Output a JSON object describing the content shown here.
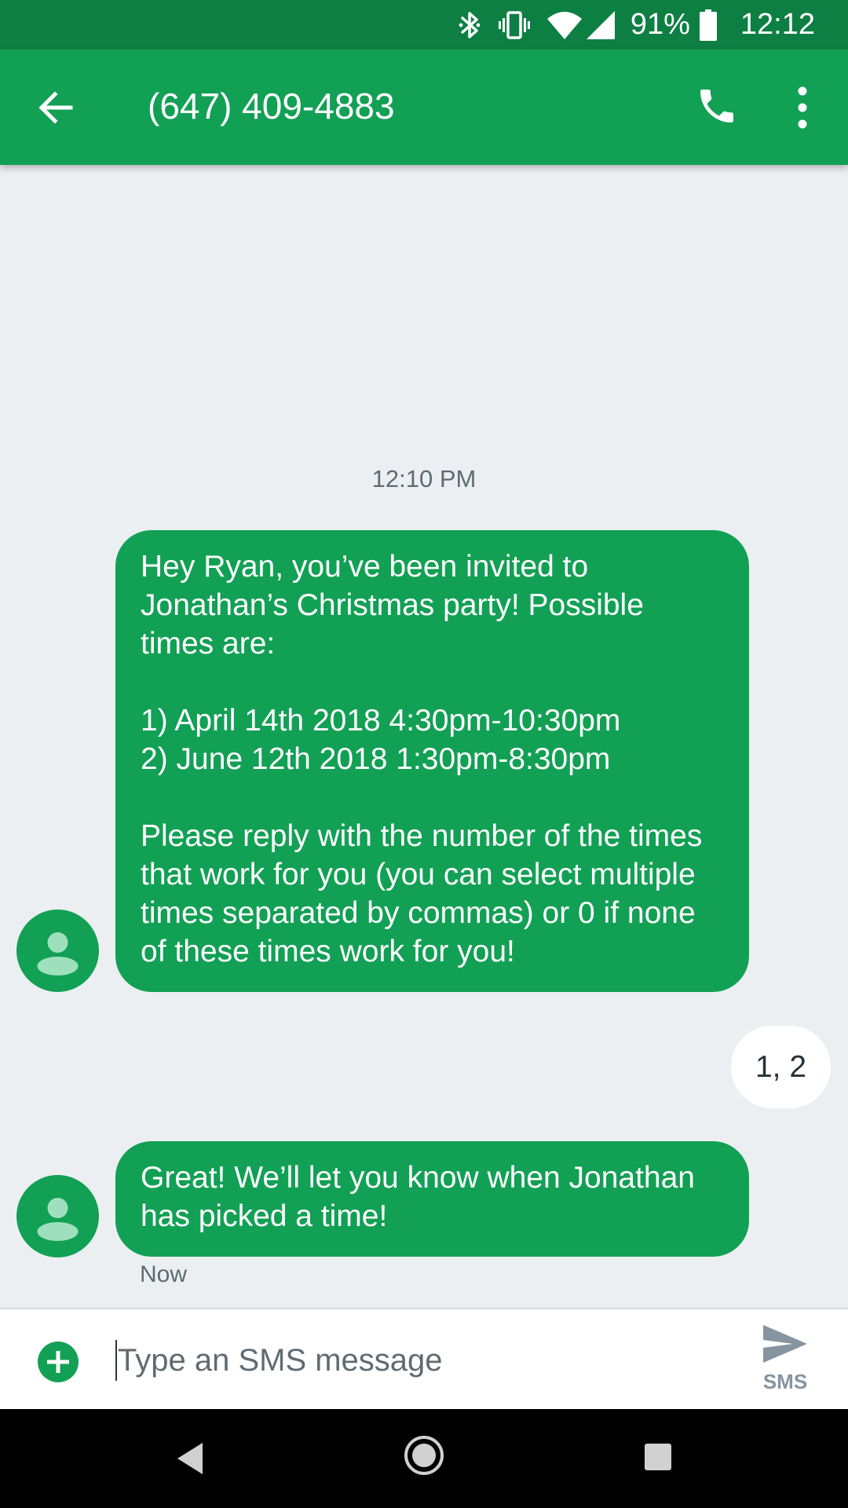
{
  "status_bar": {
    "battery_percent": "91%",
    "clock": "12:12",
    "icons": [
      "bluetooth-icon",
      "vibrate-icon",
      "wifi-icon",
      "cell-signal-icon",
      "battery-icon"
    ]
  },
  "app_bar": {
    "title": "(647) 409-4883",
    "icons": [
      "back-arrow-icon",
      "phone-icon",
      "more-vert-icon"
    ],
    "color": "#12a055"
  },
  "conversation": {
    "header_time": "12:10 PM",
    "messages": [
      {
        "direction": "incoming",
        "text": "Hey Ryan, you’ve been invited to Jonathan’s Christmas party! Possible times are:\n\n1) April 14th 2018 4:30pm-10:30pm\n2) June 12th 2018 1:30pm-8:30pm\n\nPlease reply with the number of the times that work for you (you can select multiple times separated by commas) or 0 if none of these times work for you!"
      },
      {
        "direction": "outgoing",
        "text": "1, 2"
      },
      {
        "direction": "incoming",
        "text": "Great! We’ll let you know when Jonathan has picked a time!",
        "time": "Now"
      }
    ]
  },
  "compose": {
    "placeholder": "Type an SMS message",
    "value": "",
    "send_label": "SMS",
    "icons": [
      "add-circle-icon",
      "send-icon"
    ]
  },
  "nav_bar": {
    "icons": [
      "nav-back-icon",
      "nav-home-icon",
      "nav-recents-icon"
    ]
  }
}
